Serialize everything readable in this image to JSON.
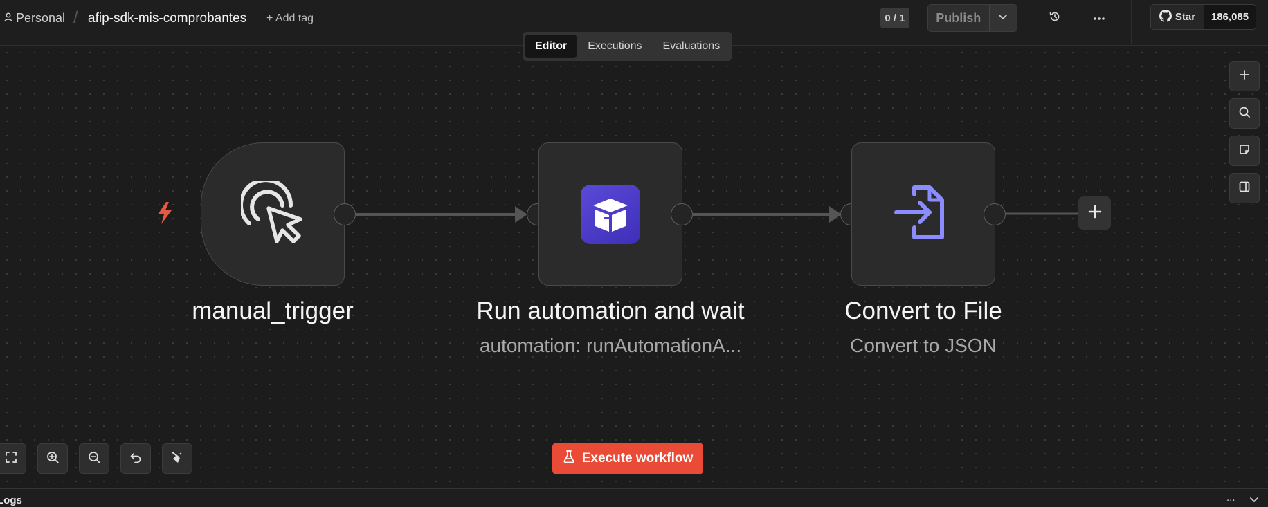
{
  "header": {
    "breadcrumb_personal": "Personal",
    "breadcrumb_separator": "/",
    "workflow_name": "afip-sdk-mis-comprobantes",
    "add_tag": "+ Add tag",
    "counter": "0 / 1",
    "publish": "Publish",
    "github_star": "Star",
    "github_count": "186,085"
  },
  "tabs": [
    {
      "label": "Editor",
      "active": true
    },
    {
      "label": "Executions",
      "active": false
    },
    {
      "label": "Evaluations",
      "active": false
    }
  ],
  "nodes": [
    {
      "title": "manual_trigger",
      "subtitle": "",
      "icon": "cursor-click-icon"
    },
    {
      "title": "Run automation and wait",
      "subtitle": "automation: runAutomationA...",
      "icon": "box-icon"
    },
    {
      "title": "Convert to File",
      "subtitle": "Convert to JSON",
      "icon": "file-export-icon"
    }
  ],
  "execute_button": "Execute workflow",
  "logs": {
    "label": "Logs",
    "more": "..."
  },
  "colors": {
    "accent_red": "#ea4b37",
    "trigger_bolt": "#e55843",
    "automation_icon_bg": "#4f3fd0",
    "file_icon": "#8b8cff",
    "canvas_bg": "#1c1c1c"
  }
}
